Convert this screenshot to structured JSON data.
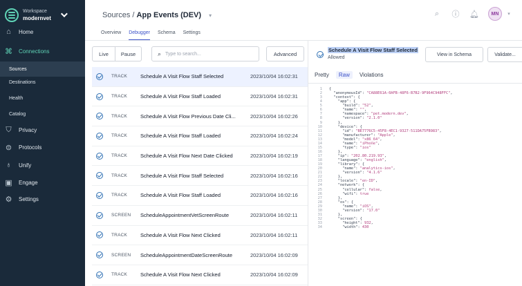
{
  "sidebar": {
    "workspace_label": "Workspace",
    "workspace_name": "modernvet",
    "nav": [
      {
        "label": "Home",
        "icon": "home-icon"
      },
      {
        "label": "Connections",
        "icon": "connections-icon"
      },
      {
        "label": "Privacy",
        "icon": "shield-icon"
      },
      {
        "label": "Protocols",
        "icon": "protocols-icon"
      },
      {
        "label": "Unify",
        "icon": "unify-icon"
      },
      {
        "label": "Engage",
        "icon": "engage-icon"
      },
      {
        "label": "Settings",
        "icon": "gear-icon"
      }
    ],
    "sub_items": [
      "Sources",
      "Destinations",
      "Health",
      "Catalog"
    ]
  },
  "header": {
    "breadcrumb_parent": "Sources",
    "breadcrumb_sep": "/",
    "breadcrumb_current": "App Events (DEV)",
    "avatar": "MN",
    "tabs": [
      "Overview",
      "Debugger",
      "Schema",
      "Settings"
    ],
    "active_tab": "Debugger"
  },
  "toolbar": {
    "live": "Live",
    "pause": "Pause",
    "search_placeholder": "Type to search...",
    "advanced": "Advanced"
  },
  "events": [
    {
      "type": "TRACK",
      "name": "Schedule A Visit Flow Staff Selected",
      "time": "2023/10/04 16:02:31",
      "selected": true
    },
    {
      "type": "TRACK",
      "name": "Schedule A Visit Flow Staff Loaded",
      "time": "2023/10/04 16:02:31"
    },
    {
      "type": "TRACK",
      "name": "Schedule A Visit Flow Previous Date Cli...",
      "time": "2023/10/04 16:02:26"
    },
    {
      "type": "TRACK",
      "name": "Schedule A Visit Flow Staff Loaded",
      "time": "2023/10/04 16:02:24"
    },
    {
      "type": "TRACK",
      "name": "Schedule A Visit Flow Next Date Clicked",
      "time": "2023/10/04 16:02:19"
    },
    {
      "type": "TRACK",
      "name": "Schedule A Visit Flow Staff Selected",
      "time": "2023/10/04 16:02:16"
    },
    {
      "type": "TRACK",
      "name": "Schedule A Visit Flow Staff Loaded",
      "time": "2023/10/04 16:02:16"
    },
    {
      "type": "SCREEN",
      "name": "ScheduleAppointmentVetScreenRoute",
      "time": "2023/10/04 16:02:11"
    },
    {
      "type": "TRACK",
      "name": "Schedule A Visit Flow Next Clicked",
      "time": "2023/10/04 16:02:11"
    },
    {
      "type": "SCREEN",
      "name": "ScheduleAppointmentDateScreenRoute",
      "time": "2023/10/04 16:02:09"
    },
    {
      "type": "TRACK",
      "name": "Schedule A Visit Flow Next Clicked",
      "time": "2023/10/04 16:02:09"
    }
  ],
  "detail": {
    "title": "Schedule A Visit Flow Staff Selected",
    "status": "Allowed",
    "view_schema": "View in Schema",
    "validate": "Validate...",
    "tabs": [
      "Pretty",
      "Raw",
      "Violations"
    ],
    "active_tab": "Raw",
    "code_lines": [
      "{",
      "  \"anonymousId\": \"CA88E61A-0AFB-48F6-B7B2-9F964C948FFC\",",
      "  \"context\": {",
      "    \"app\": {",
      "      \"build\": \"52\",",
      "      \"name\": \"\",",
      "      \"namespace\": \"pet.modern.dev\",",
      "      \"version\": \"2.1.0\"",
      "    },",
      "    \"device\": {",
      "      \"id\": \"BE7776C5-45F8-4EC1-9327-511DA75FB983\",",
      "      \"manufacturer\": \"Apple\",",
      "      \"model\": \"x86_64\",",
      "      \"name\": \"iPhone\",",
      "      \"type\": \"ios\"",
      "    },",
      "    \"ip\": \"202.80.219.93\",",
      "    \"language\": \"english\",",
      "    \"library\": {",
      "      \"name\": \"analytics-ios\",",
      "      \"version\": \"4.1.6\"",
      "    },",
      "    \"locale\": \"en-ID\",",
      "    \"network\": {",
      "      \"cellular\": false,",
      "      \"wifi\": true",
      "    },",
      "    \"os\": {",
      "      \"name\": \"iOS\",",
      "      \"version\": \"17.0\"",
      "    },",
      "    \"screen\": {",
      "      \"height\": 932,",
      "      \"width\": 430"
    ]
  },
  "colors": {
    "sidebar_bg": "#1a2a3a",
    "accent_green": "#5fd3b6",
    "accent_blue": "#3b50c8",
    "selected_row": "#edf2ff"
  }
}
